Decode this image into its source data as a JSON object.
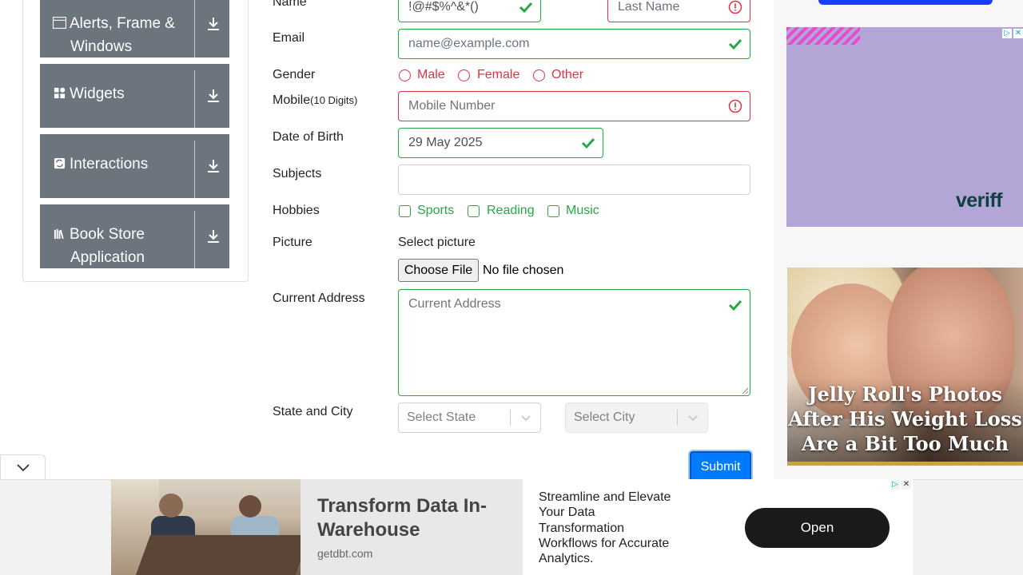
{
  "sidebar": {
    "groups": [
      {
        "label_line1": "Alerts, Frame &",
        "label_line2": "Windows",
        "icon": "window-icon"
      },
      {
        "label_line1": "Widgets",
        "label_line2": "",
        "icon": "widgets-icon"
      },
      {
        "label_line1": "Interactions",
        "label_line2": "",
        "icon": "interactions-icon"
      },
      {
        "label_line1": "Book Store",
        "label_line2": "Application",
        "icon": "books-icon"
      }
    ]
  },
  "form": {
    "name_label": "Name",
    "first_name_value": "!@#$%^&*()",
    "last_name_placeholder": "Last Name",
    "email_label": "Email",
    "email_placeholder": "name@example.com",
    "gender_label": "Gender",
    "gender_options": [
      "Male",
      "Female",
      "Other"
    ],
    "mobile_label": "Mobile",
    "mobile_hint": "(10 Digits)",
    "mobile_placeholder": "Mobile Number",
    "dob_label": "Date of Birth",
    "dob_value": "29 May 2025",
    "subjects_label": "Subjects",
    "hobbies_label": "Hobbies",
    "hobby_options": [
      "Sports",
      "Reading",
      "Music"
    ],
    "picture_label": "Picture",
    "picture_select_text": "Select picture",
    "choose_file_label": "Choose File",
    "no_file_text": "No file chosen",
    "address_label": "Current Address",
    "address_placeholder": "Current Address",
    "state_city_label": "State and City",
    "state_placeholder": "Select State",
    "city_placeholder": "Select City",
    "submit_label": "Submit"
  },
  "ads": {
    "right_top_brand": "veriff",
    "right_bottom_headline": "Jelly Roll's Photos After His Weight Loss Are a Bit Too Much",
    "bottom_title": "Transform Data In-Warehouse",
    "bottom_url": "getdbt.com",
    "bottom_description": "Streamline and Elevate Your Data Transformation Workflows for Accurate Analytics.",
    "bottom_cta": "Open"
  },
  "colors": {
    "valid": "#28a745",
    "invalid": "#dc3545",
    "sidebar_group": "#6c757d",
    "submit": "#007bff"
  }
}
